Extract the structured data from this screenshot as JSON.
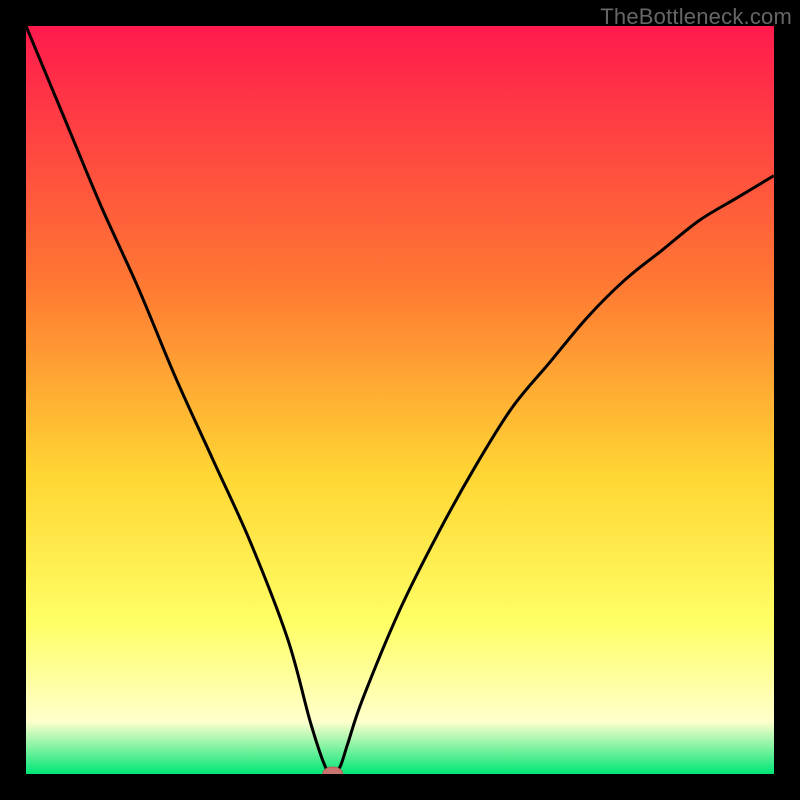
{
  "watermark": "TheBottleneck.com",
  "colors": {
    "frame": "#000000",
    "curve": "#000000",
    "marker_fill": "#c9746f",
    "marker_stroke": "#b95f5a",
    "gradient_top": "#ff1a4d",
    "gradient_mid_upper": "#ff7a33",
    "gradient_mid": "#ffd633",
    "gradient_mid_lower": "#ffff66",
    "gradient_cream": "#ffffcc",
    "gradient_bottom": "#00e676"
  },
  "chart_data": {
    "type": "line",
    "title": "",
    "xlabel": "",
    "ylabel": "",
    "xlim": [
      0,
      100
    ],
    "ylim": [
      0,
      100
    ],
    "series": [
      {
        "name": "bottleneck-curve",
        "x": [
          0,
          5,
          10,
          15,
          20,
          25,
          30,
          35,
          38,
          40,
          41,
          42,
          43,
          45,
          50,
          55,
          60,
          65,
          70,
          75,
          80,
          85,
          90,
          95,
          100
        ],
        "y": [
          100,
          88,
          76,
          65,
          53,
          42,
          31,
          18,
          7,
          1,
          0,
          1,
          4,
          10,
          22,
          32,
          41,
          49,
          55,
          61,
          66,
          70,
          74,
          77,
          80
        ]
      }
    ],
    "marker": {
      "x": 41,
      "y": 0
    },
    "gradient_bands_pct": [
      {
        "stop": 0,
        "color": "#ff1a4d"
      },
      {
        "stop": 35,
        "color": "#ff7a33"
      },
      {
        "stop": 60,
        "color": "#ffd633"
      },
      {
        "stop": 80,
        "color": "#ffff66"
      },
      {
        "stop": 93,
        "color": "#ffffcc"
      },
      {
        "stop": 100,
        "color": "#00e676"
      }
    ]
  }
}
